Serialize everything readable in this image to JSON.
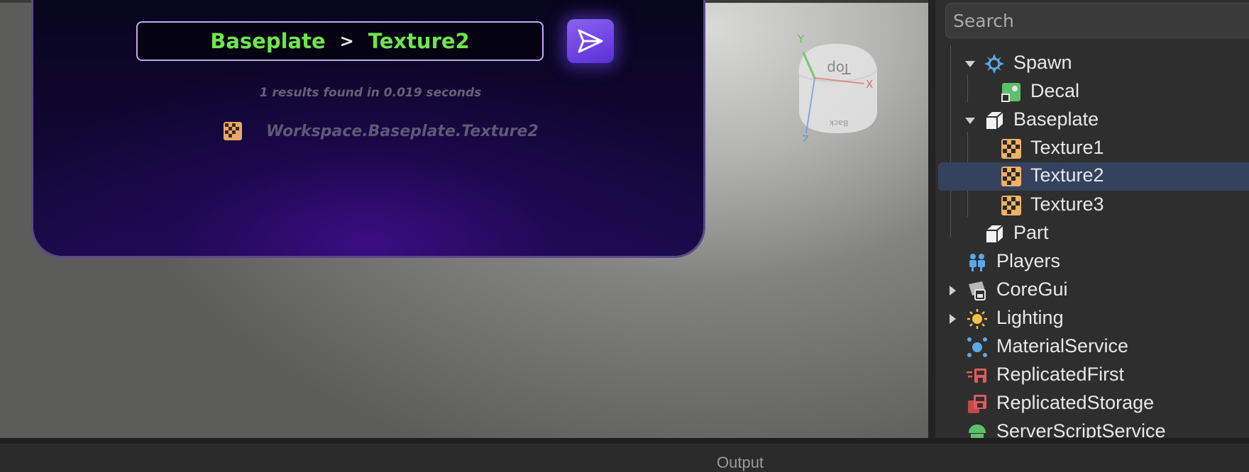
{
  "search_panel": {
    "breadcrumb": [
      "Baseplate",
      "Texture2"
    ],
    "breadcrumb_separator": ">",
    "results_summary": "1 results found in 0.019 seconds",
    "result": {
      "path": "Workspace.Baseplate.Texture2",
      "icon": "texture-icon"
    },
    "send_icon": "paper-plane-icon"
  },
  "viewcube": {
    "face_label": "Top",
    "back_label": "Back",
    "axes": [
      "Y",
      "X",
      "Z"
    ]
  },
  "explorer": {
    "search_placeholder": "Search",
    "items": [
      {
        "label": "Spawn",
        "icon": "spawn-icon",
        "expanded": true
      },
      {
        "label": "Decal",
        "icon": "decal-icon"
      },
      {
        "label": "Baseplate",
        "icon": "part-icon",
        "expanded": true
      },
      {
        "label": "Texture1",
        "icon": "texture-icon"
      },
      {
        "label": "Texture2",
        "icon": "texture-icon",
        "selected": true
      },
      {
        "label": "Texture3",
        "icon": "texture-icon"
      },
      {
        "label": "Part",
        "icon": "part-icon"
      },
      {
        "label": "Players",
        "icon": "players-icon"
      },
      {
        "label": "CoreGui",
        "icon": "coregui-icon",
        "expanded": false
      },
      {
        "label": "Lighting",
        "icon": "lighting-icon",
        "expanded": false
      },
      {
        "label": "MaterialService",
        "icon": "material-service-icon"
      },
      {
        "label": "ReplicatedFirst",
        "icon": "replicated-first-icon"
      },
      {
        "label": "ReplicatedStorage",
        "icon": "replicated-storage-icon"
      },
      {
        "label": "ServerScriptService",
        "icon": "server-script-service-icon"
      }
    ]
  },
  "output_panel": {
    "title": "Output"
  },
  "colors": {
    "accent_green": "#6ee64c",
    "accent_purple": "#6b3fe6",
    "selection": "#34415f"
  }
}
